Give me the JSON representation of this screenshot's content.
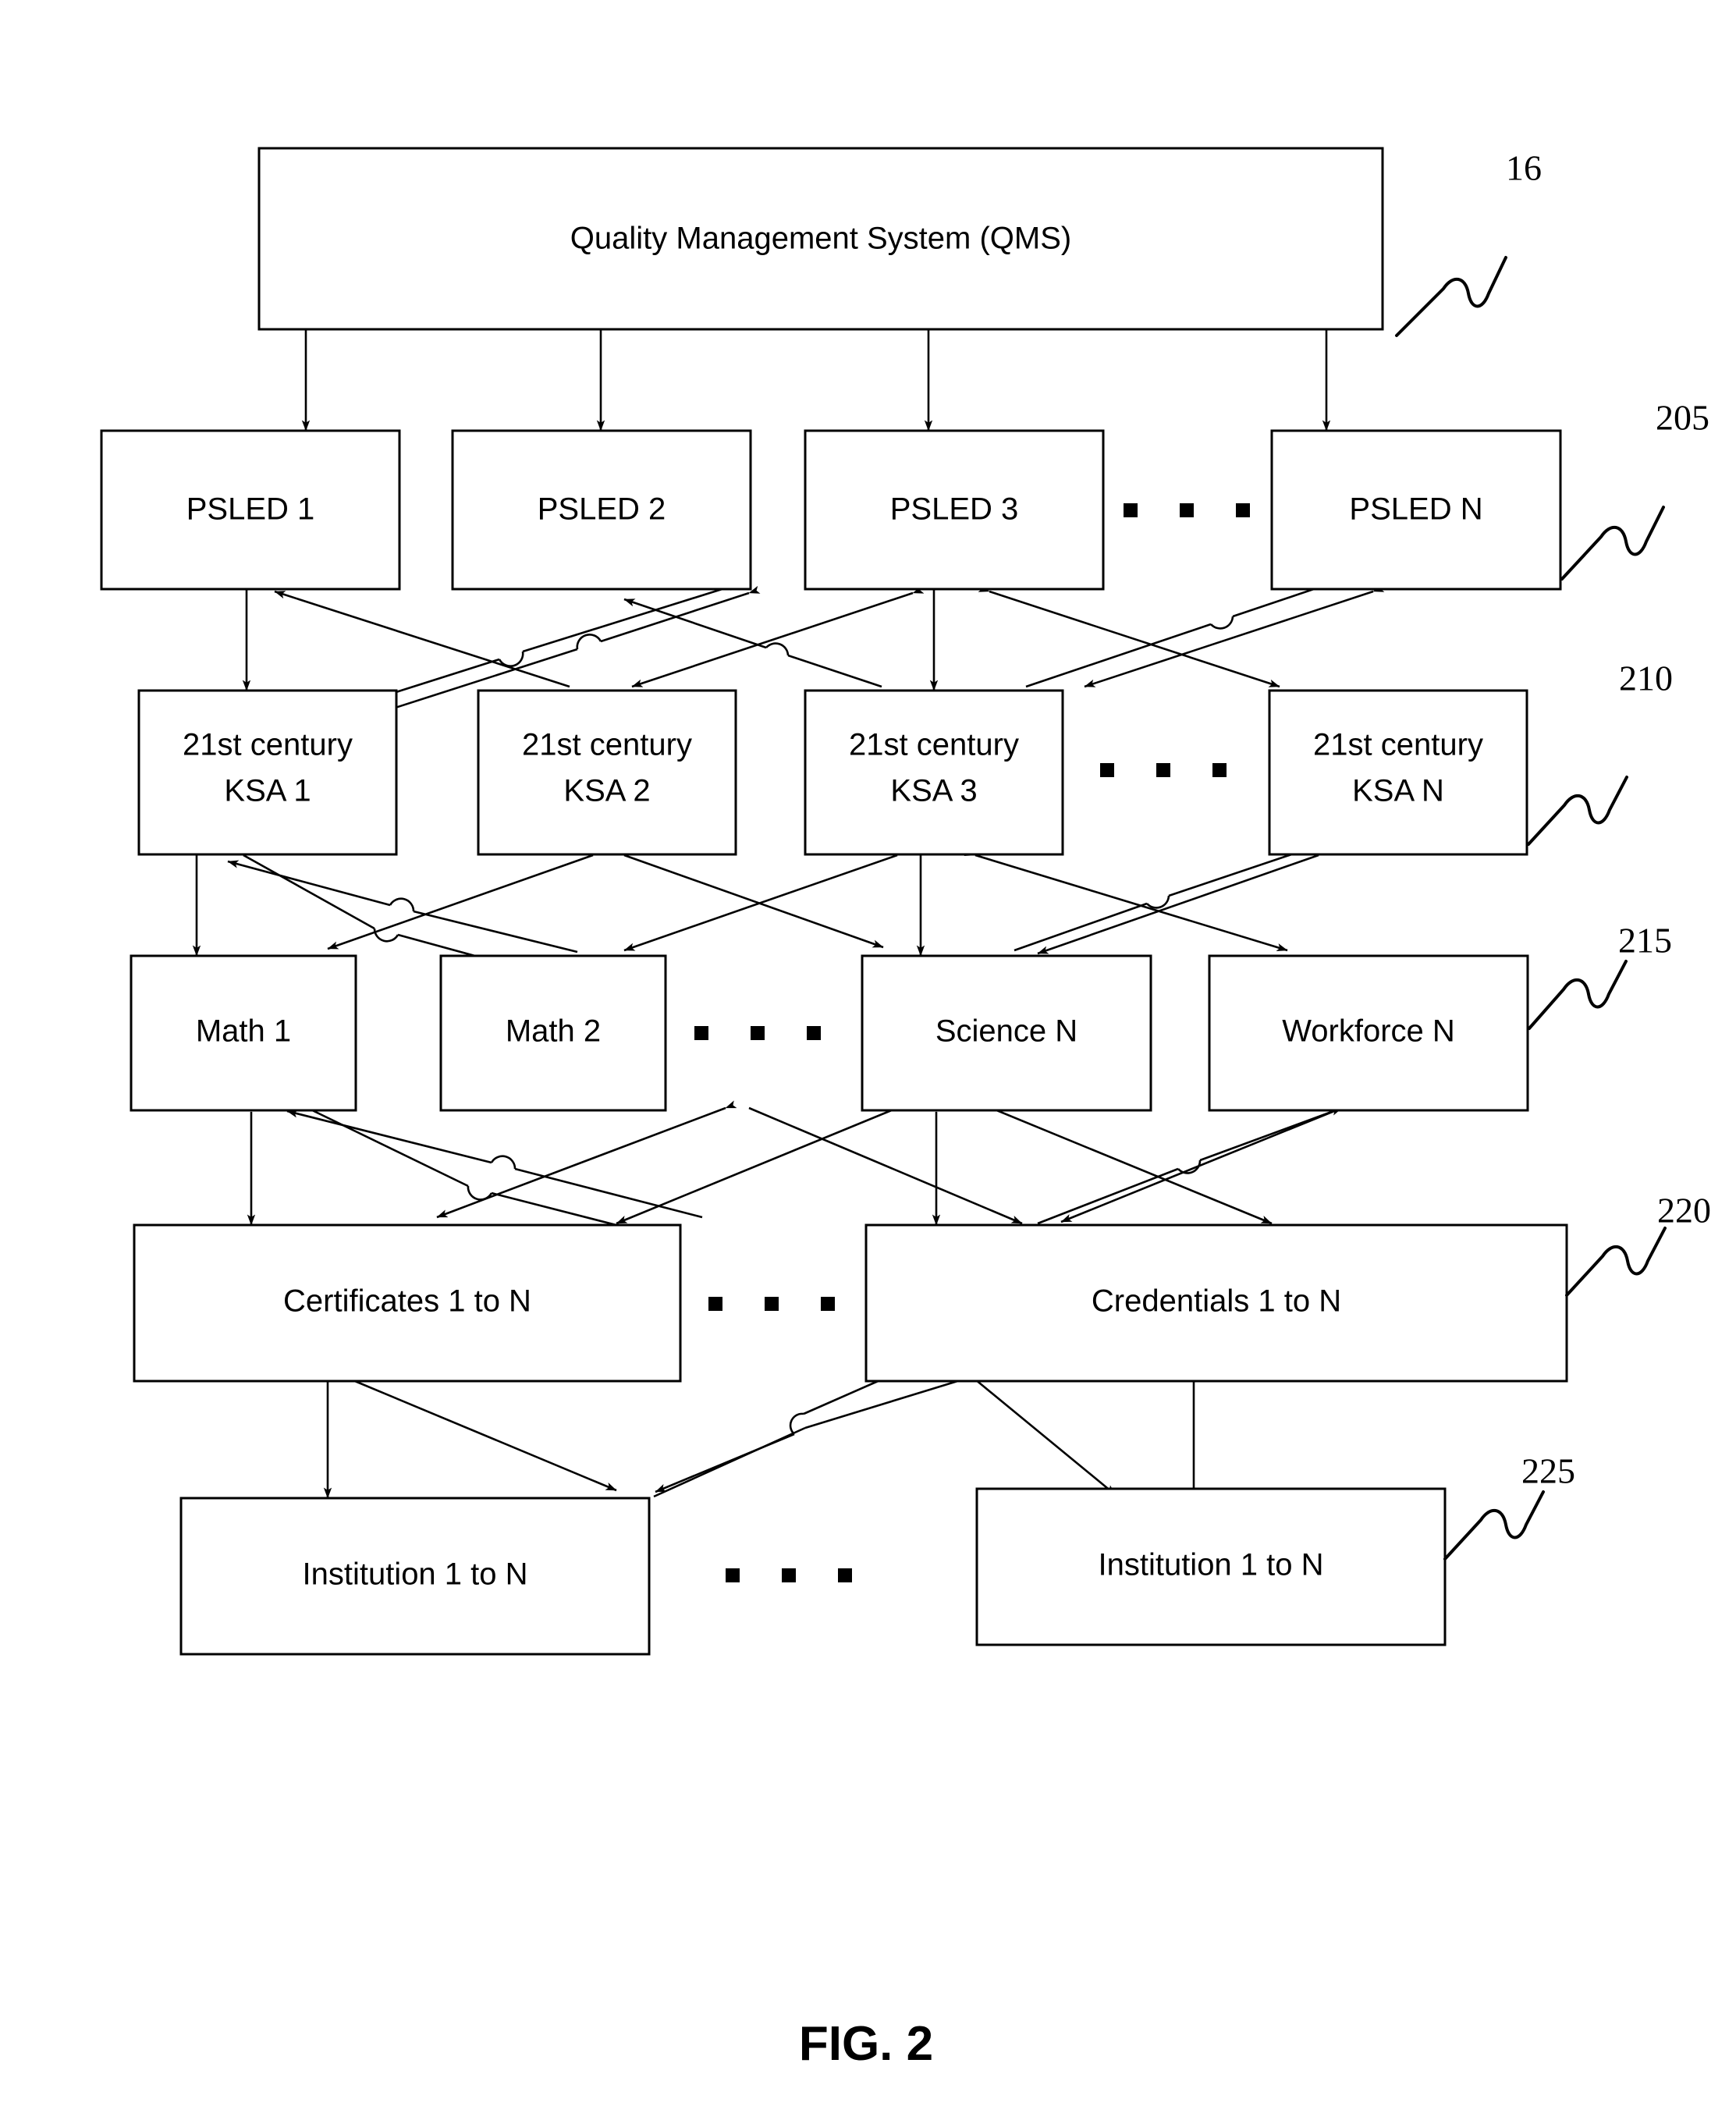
{
  "figure": {
    "caption": "FIG. 2",
    "ellipsis_symbol": "▪"
  },
  "rows": [
    {
      "ref": "16",
      "name": "quality-management-system-row",
      "boxes": [
        {
          "label": "Quality Management System (QMS)"
        }
      ]
    },
    {
      "ref": "205",
      "name": "psled-row",
      "boxes": [
        {
          "label": "PSLED 1"
        },
        {
          "label": "PSLED 2"
        },
        {
          "label": "PSLED 3"
        },
        {
          "label": "PSLED N"
        }
      ],
      "ellipsis_after": 2
    },
    {
      "ref": "210",
      "name": "ksa-row",
      "boxes": [
        {
          "label_line1": "21st century",
          "label_line2": "KSA 1"
        },
        {
          "label_line1": "21st century",
          "label_line2": "KSA 2"
        },
        {
          "label_line1": "21st century",
          "label_line2": "KSA 3"
        },
        {
          "label_line1": "21st century",
          "label_line2": "KSA N"
        }
      ],
      "ellipsis_after": 2
    },
    {
      "ref": "215",
      "name": "subject-row",
      "boxes": [
        {
          "label": "Math 1"
        },
        {
          "label": "Math 2"
        },
        {
          "label": "Science N"
        },
        {
          "label": "Workforce N"
        }
      ],
      "ellipsis_after": 1
    },
    {
      "ref": "220",
      "name": "awards-row",
      "boxes": [
        {
          "label": "Certificates 1 to N"
        },
        {
          "label": "Credentials 1 to N"
        }
      ],
      "ellipsis_after": 0
    },
    {
      "ref": "225",
      "name": "institution-row",
      "boxes": [
        {
          "label": "Institution 1 to N"
        },
        {
          "label": "Institution 1 to N"
        }
      ],
      "ellipsis_after": 0
    }
  ],
  "colors": {
    "stroke": "#000000",
    "fill": "#ffffff",
    "text": "#000000",
    "background": "#ffffff"
  }
}
